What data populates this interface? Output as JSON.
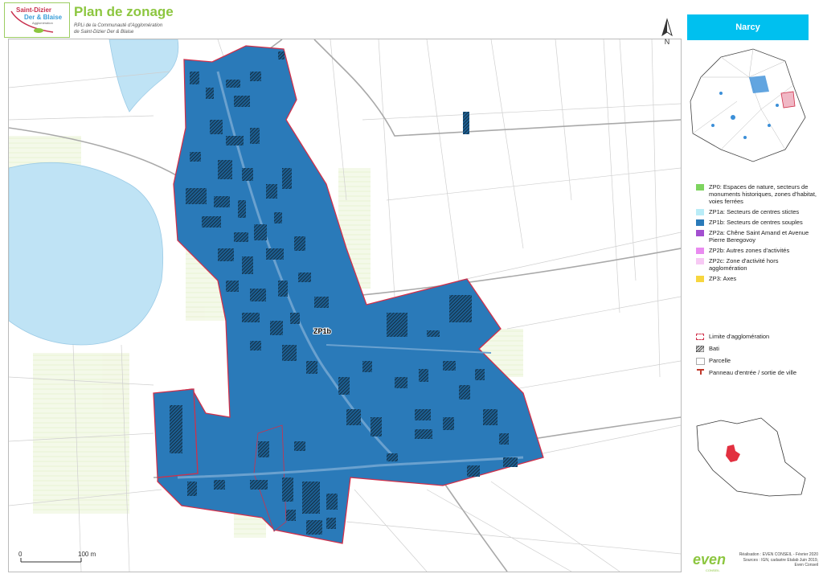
{
  "header": {
    "logo_line1": "Saint-Dizier",
    "logo_line2": "Der & Blaise",
    "logo_line3": "Agglomération",
    "title": "Plan de zonage",
    "subtitle_line1": "RPLi de la Communauté d'Agglomération",
    "subtitle_line2": "de Saint-Dizier Der & Blaise"
  },
  "north_label": "N",
  "town_name": "Narcy",
  "map": {
    "zone_label": "ZP1b",
    "scale_start": "0",
    "scale_end": "100 m",
    "colors": {
      "zone_fill": "#2a7ab9",
      "zone_border": "#d0304a",
      "water": "#bfe3f5",
      "agri": "#eef5dc"
    }
  },
  "legend": {
    "zones": [
      {
        "label": "ZP0: Espaces de nature, secteurs de monuments historiques, zones d'habitat, voies ferrées",
        "color": "#7dd45f"
      },
      {
        "label": "ZP1a: Secteurs de centres stictes",
        "color": "#b9ecf7"
      },
      {
        "label": "ZP1b: Secteurs de centres souples",
        "color": "#2a7ab9"
      },
      {
        "label": "ZP2a: Chêne Saint Amand et Avenue Pierre Beregovoy",
        "color": "#a34fd0"
      },
      {
        "label": "ZP2b: Autres zones d'activités",
        "color": "#e98bf0"
      },
      {
        "label": "ZP2c: Zone d'activité hors agglomération",
        "color": "#f7c9f4"
      },
      {
        "label": "ZP3: Axes",
        "color": "#f7d63f"
      }
    ],
    "symbols": {
      "limite": "Limite d'agglomération",
      "bati": "Bati",
      "parcelle": "Parcelle",
      "panneau": "Panneau d'entrée / sortie de ville"
    }
  },
  "credits": {
    "line1": "Réalisation : EVEN CONSEIL - Février 2020",
    "line2": "Sources : IGN, cadastre Etalab Juin 2019,",
    "line3": "Even Conseil"
  },
  "brand": "even",
  "brand_sub": "CONSEIL"
}
